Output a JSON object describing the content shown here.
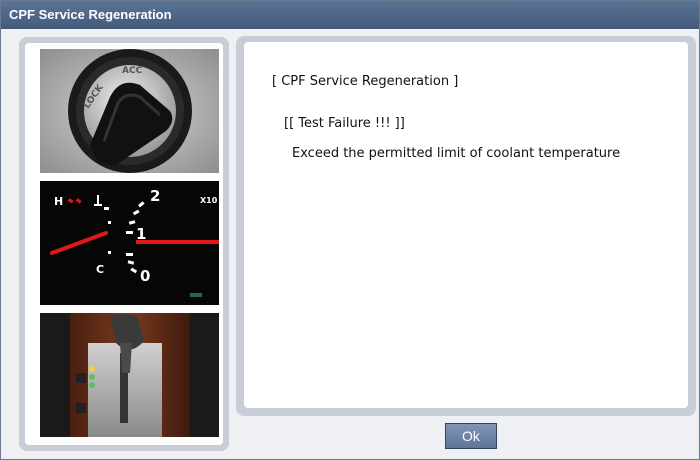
{
  "window": {
    "title": "CPF Service Regeneration"
  },
  "content": {
    "heading": "[ CPF Service Regeneration ]",
    "failure": "[[ Test Failure !!! ]]",
    "message": "Exceed the permitted limit of coolant temperature"
  },
  "gauge": {
    "label_h": "H",
    "label_c": "C",
    "label_2": "2",
    "label_1": "1",
    "label_0": "0",
    "label_x10": "X10"
  },
  "ignition": {
    "label_lock": "LOCK",
    "label_acc": "ACC"
  },
  "buttons": {
    "ok_label": "Ok"
  }
}
